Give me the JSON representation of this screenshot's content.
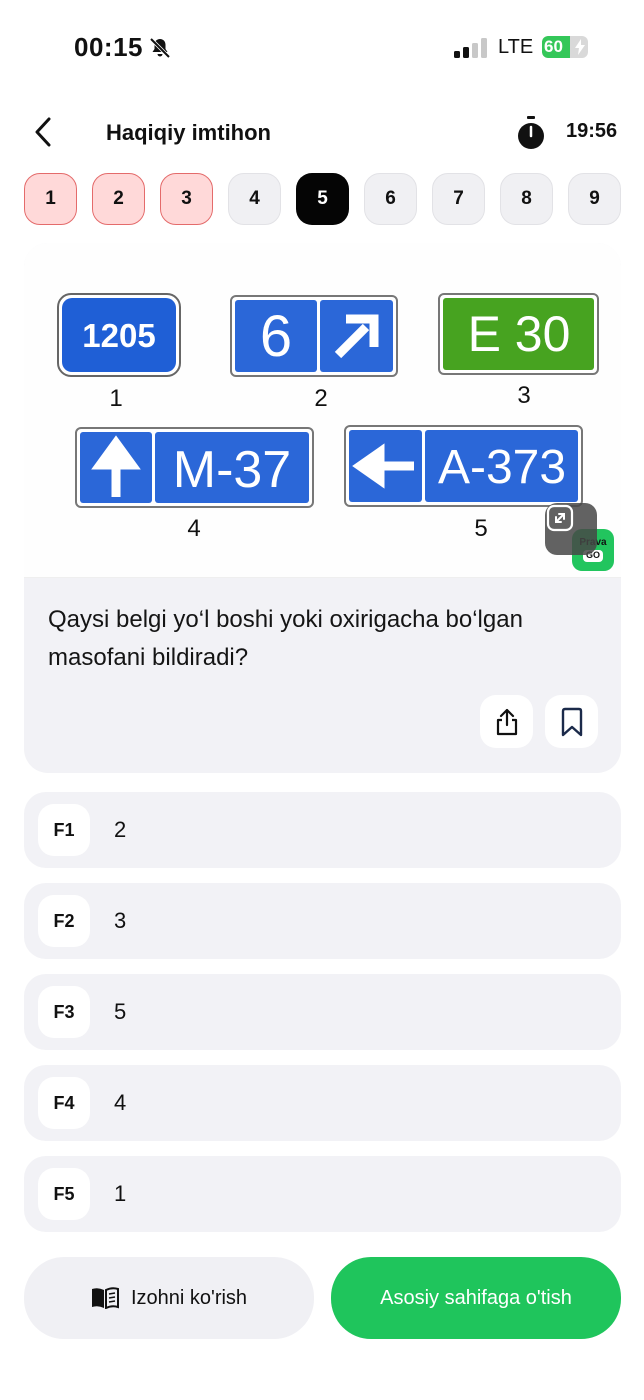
{
  "status_bar": {
    "time": "00:15",
    "network": "LTE",
    "battery": "60",
    "battery_level": 0.6,
    "icons": [
      "bell-slash-icon",
      "signal-icon",
      "battery-charging-icon"
    ]
  },
  "header": {
    "title": "Haqiqiy imtihon",
    "timer": "19:56",
    "icons": [
      "chevron-left-icon",
      "stopwatch-icon"
    ]
  },
  "question_nav": [
    {
      "label": "1",
      "state": "wrong"
    },
    {
      "label": "2",
      "state": "wrong"
    },
    {
      "label": "3",
      "state": "wrong"
    },
    {
      "label": "4",
      "state": "default"
    },
    {
      "label": "5",
      "state": "active"
    },
    {
      "label": "6",
      "state": "default"
    },
    {
      "label": "7",
      "state": "default"
    },
    {
      "label": "8",
      "state": "default"
    },
    {
      "label": "9",
      "state": "default"
    }
  ],
  "question_image": {
    "signs": [
      {
        "text": "1205",
        "label": "1"
      },
      {
        "text": "6",
        "label": "2"
      },
      {
        "text": "E 30",
        "label": "3"
      },
      {
        "text": "M-37",
        "label": "4"
      },
      {
        "text": "A-373",
        "label": "5"
      }
    ],
    "brand_text": "Prava",
    "brand_badge": "GO"
  },
  "question": {
    "text": "Qaysi belgi yo‘l boshi yoki oxirigacha bo‘lgan masofani bildiradi?"
  },
  "answers": [
    {
      "key": "F1",
      "value": "2"
    },
    {
      "key": "F2",
      "value": "3"
    },
    {
      "key": "F3",
      "value": "5"
    },
    {
      "key": "F4",
      "value": "4"
    },
    {
      "key": "F5",
      "value": "1"
    }
  ],
  "buttons": {
    "explain": "Izohni ko'rish",
    "home": "Asosiy sahifaga o'tish"
  },
  "colors": {
    "accent_green": "#1fc55c",
    "sign_blue": "#1f5fd6",
    "sign_green": "#47a320",
    "wrong_bg": "#ffd9d9",
    "wrong_border": "#e46b6b"
  }
}
